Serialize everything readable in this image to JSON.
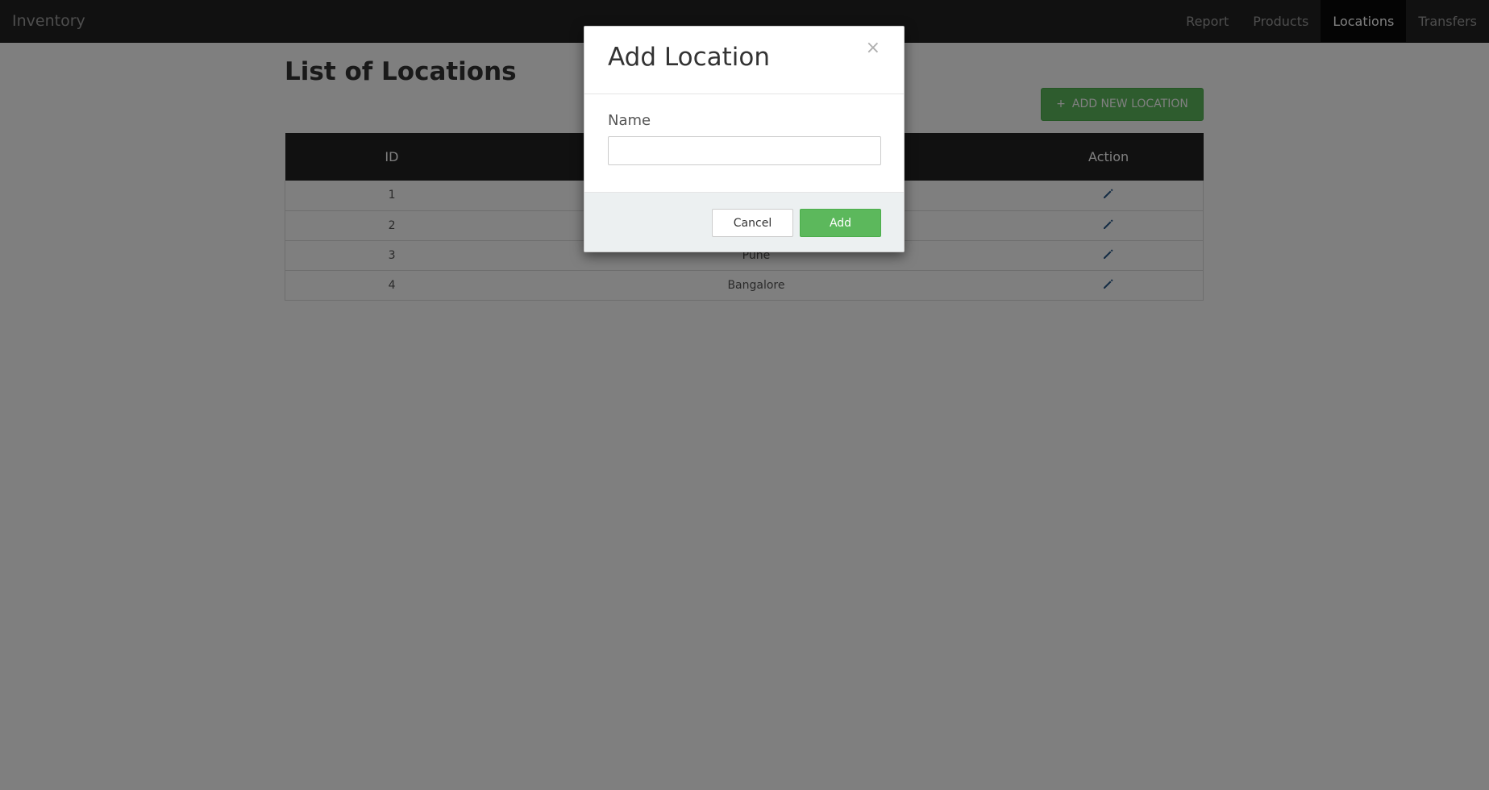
{
  "navbar": {
    "brand": "Inventory",
    "items": [
      {
        "label": "Report"
      },
      {
        "label": "Products"
      },
      {
        "label": "Locations",
        "active": true
      },
      {
        "label": "Transfers"
      }
    ]
  },
  "page": {
    "title": "List of Locations",
    "add_button_label": "ADD NEW LOCATION",
    "add_button_icon": "+"
  },
  "table": {
    "headers": {
      "id": "ID",
      "name": "",
      "action": "Action"
    },
    "rows": [
      {
        "id": "1",
        "name": "",
        "action_icon": "pencil-icon"
      },
      {
        "id": "2",
        "name": "",
        "action_icon": "pencil-icon"
      },
      {
        "id": "3",
        "name": "Pune",
        "action_icon": "pencil-icon"
      },
      {
        "id": "4",
        "name": "Bangalore",
        "action_icon": "pencil-icon"
      }
    ]
  },
  "modal": {
    "title": "Add Location",
    "close_glyph": "×",
    "field_label": "Name",
    "field_value": "",
    "cancel_label": "Cancel",
    "submit_label": "Add"
  },
  "colors": {
    "navbar_bg": "#222222",
    "success": "#5cb85c",
    "modal_footer_bg": "#ecf0f1",
    "icon_blue": "#337ab7"
  }
}
